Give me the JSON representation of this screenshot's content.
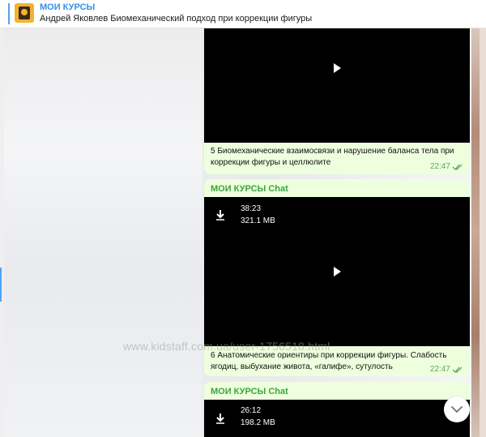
{
  "pinned": {
    "title": "МОИ КУРСЫ",
    "subtitle": "Андрей Яковлев Биомеханический подход при коррекции фигуры"
  },
  "messages": [
    {
      "caption_line1": "5 Биомеханические взаимосвязи и нарушение баланса тела при",
      "caption_line2": "коррекции фигуры и целлюлите",
      "time": "22:47"
    },
    {
      "sender": "МОИ КУРСЫ Chat",
      "duration": "38:23",
      "size": "321.1 MB",
      "caption_line1": "6 Анатомические ориентиры при коррекции фигуры. Слабость",
      "caption_line2": "ягодиц, выбухание живота, «галифе», сутулость",
      "time": "22:47"
    },
    {
      "sender": "МОИ КУРСЫ Chat",
      "duration": "26:12",
      "size": "198.2 MB"
    }
  ],
  "watermark": "www.kidstaff.com.ua/user-1756518.html",
  "colors": {
    "accent": "#3390ec",
    "bubble": "#eeffde",
    "sender": "#3fa33f",
    "time": "#5ca65c"
  }
}
